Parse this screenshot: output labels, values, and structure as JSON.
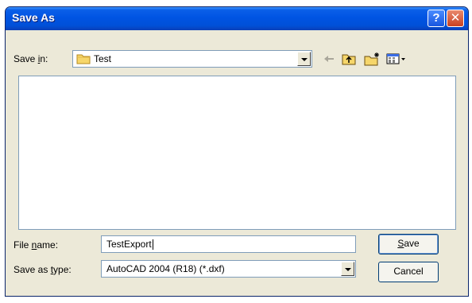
{
  "window": {
    "title": "Save As",
    "help_glyph": "?",
    "close_glyph": "✕"
  },
  "save_in": {
    "label_prefix": "Save ",
    "label_mnemonic": "i",
    "label_suffix": "n:",
    "value": "Test",
    "icon": "folder-icon"
  },
  "toolbar": {
    "icons": [
      "back-arrow-icon",
      "up-one-level-icon",
      "create-new-folder-icon",
      "view-menu-icon"
    ]
  },
  "file_name": {
    "label_prefix": "File ",
    "label_mnemonic": "n",
    "label_suffix": "ame:",
    "value": "TestExport"
  },
  "save_as_type": {
    "label_prefix": "Save as ",
    "label_mnemonic": "t",
    "label_suffix": "ype:",
    "value": "AutoCAD 2004 (R18) (*.dxf)"
  },
  "buttons": {
    "save_mnemonic": "S",
    "save_rest": "ave",
    "cancel": "Cancel"
  },
  "colors": {
    "titlebar": "#0054e3",
    "window_bg": "#ece9d8",
    "field_border": "#7f9db9"
  }
}
